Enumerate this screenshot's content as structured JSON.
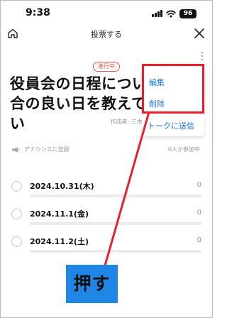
{
  "status_bar": {
    "time": "9:38",
    "battery": "96"
  },
  "header": {
    "title": "投票する"
  },
  "poll": {
    "status": "進行中",
    "title": "役員会の日程についてご都合の良い日を教えてください",
    "meta": "作成者: 三木太郎 ｜ 複数選択",
    "announce_label": "アナウンスに登録",
    "participants": "0人が参加中",
    "options": [
      {
        "label": "2024.10.31(木)",
        "count": "0",
        "progress": 0
      },
      {
        "label": "2024.11.1(金)",
        "count": "0",
        "progress": 0
      },
      {
        "label": "2024.11.2(土)",
        "count": "0",
        "progress": 0
      }
    ]
  },
  "menu": {
    "items": [
      "編集",
      "削除",
      "トークに送信"
    ]
  },
  "annotation": {
    "callout": "押す"
  },
  "colors": {
    "accent_blue": "#1677e0",
    "highlight_red": "#e8202e",
    "status_red": "#e25b4d",
    "callout_blue": "#1f86e6"
  },
  "icons": [
    "home-icon",
    "close-icon",
    "more-vertical-icon",
    "megaphone-icon",
    "wifi-icon",
    "signal-icon"
  ]
}
